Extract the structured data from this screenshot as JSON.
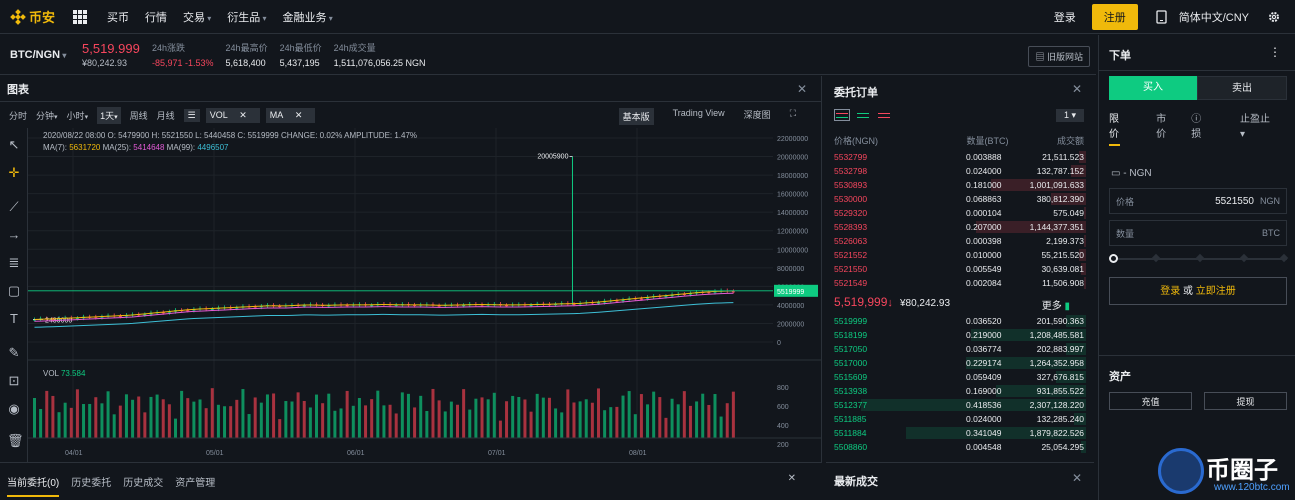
{
  "header": {
    "logo_text": "币安",
    "nav": [
      "买币",
      "行情",
      "交易",
      "衍生品",
      "金融业务"
    ],
    "nav_dropdown": [
      false,
      false,
      true,
      true,
      true
    ],
    "login": "登录",
    "register": "注册",
    "language": "简体中文/CNY"
  },
  "ticker": {
    "pair": "BTC/NGN",
    "last_price": "5,519.999",
    "last_price_cny": "¥80,242.93",
    "change_label": "24h涨跌",
    "change_value": "-85,971 -1.53%",
    "high_label": "24h最高价",
    "high_value": "5,618,400",
    "low_label": "24h最低价",
    "low_value": "5,437,195",
    "volume_label": "24h成交量",
    "volume_value": "1,511,076,056.25 NGN",
    "old_site": "旧版网站"
  },
  "chart_panel": {
    "title": "图表",
    "intervals": [
      "分时",
      "分钟",
      "小时",
      "1天",
      "周线",
      "月线"
    ],
    "indicators": [
      "VOL",
      "MA"
    ],
    "views": [
      "基本版",
      "Trading View",
      "深度图"
    ],
    "ohlc_line": "2020/08/22 08:00  O: 5479900  H: 5521550  L: 5440458  C: 5519999  CHANGE: 0.02%  AMPLITUDE: 1.47%",
    "ma7_label": "MA(7):",
    "ma7_value": "5631720",
    "ma25_label": "MA(25):",
    "ma25_value": "5414648",
    "ma99_label": "MA(99):",
    "ma99_value": "4496507",
    "vol_label": "VOL",
    "vol_value": "73.584",
    "peak_label": "20005900",
    "low_label": "2430000",
    "current_price_tag": "5519999",
    "y_ticks": [
      "22000000",
      "20000000",
      "18000000",
      "16000000",
      "14000000",
      "12000000",
      "10000000",
      "8000000",
      "6000000",
      "4000000",
      "2000000",
      "0"
    ],
    "vol_ticks": [
      "800",
      "600",
      "400",
      "200"
    ],
    "x_ticks": [
      "04/01",
      "05/01",
      "06/01",
      "07/01",
      "08/01"
    ]
  },
  "chart_data": {
    "type": "candlestick",
    "y_range": [
      0,
      23000000
    ],
    "close_trend": [
      2430000,
      2500000,
      2600000,
      2700000,
      2800000,
      2900000,
      3100000,
      3300000,
      3500000,
      3600000,
      3700000,
      3800000,
      3900000,
      3900000,
      4000000,
      3950000,
      4000000,
      4000000,
      4050000,
      4000000,
      4000000,
      3950000,
      4000000,
      4050000,
      4000000,
      4000000,
      4050000,
      4100000,
      4150000,
      4300000,
      4500000,
      4700000,
      4900000,
      5100000,
      5300000,
      5450000,
      5519999
    ],
    "spike": {
      "date": "07/15",
      "high": 20005900
    }
  },
  "orders": {
    "title": "委托订单",
    "group": "1",
    "columns": [
      "价格(NGN)",
      "数量(BTC)",
      "成交额"
    ],
    "asks": [
      [
        "5532799",
        "0.003888",
        "21,511.523",
        0.03
      ],
      [
        "5532798",
        "0.024000",
        "132,787.152",
        0.06
      ],
      [
        "5530893",
        "0.181000",
        "1,001,091.633",
        0.38
      ],
      [
        "5530000",
        "0.068863",
        "380,812.390",
        0.14
      ],
      [
        "5529320",
        "0.000104",
        "575.049",
        0.01
      ],
      [
        "5528393",
        "0.207000",
        "1,144,377.351",
        0.44
      ],
      [
        "5526063",
        "0.000398",
        "2,199.373",
        0.01
      ],
      [
        "5521552",
        "0.010000",
        "55,215.520",
        0.03
      ],
      [
        "5521550",
        "0.005549",
        "30,639.081",
        0.02
      ],
      [
        "5521549",
        "0.002084",
        "11,506.908",
        0.01
      ]
    ],
    "mid_price": "5,519,999",
    "mid_arrow": "↓",
    "mid_cny": "¥80,242.93",
    "more": "更多",
    "bids": [
      [
        "5519999",
        "0.036520",
        "201,590.363",
        0.08
      ],
      [
        "5518199",
        "0.219000",
        "1,208,485.581",
        0.46
      ],
      [
        "5517050",
        "0.036774",
        "202,883.997",
        0.08
      ],
      [
        "5517000",
        "0.229174",
        "1,264,352.958",
        0.48
      ],
      [
        "5515609",
        "0.059409",
        "327,676.815",
        0.12
      ],
      [
        "5513938",
        "0.169000",
        "931,855.522",
        0.36
      ],
      [
        "5512377",
        "0.418536",
        "2,307,128.220",
        0.9
      ],
      [
        "5511885",
        "0.024000",
        "132,285.240",
        0.05
      ],
      [
        "5511884",
        "0.341049",
        "1,879,822.526",
        0.72
      ],
      [
        "5508860",
        "0.004548",
        "25,054.295",
        0.02
      ]
    ]
  },
  "trade": {
    "title": "下单",
    "buy": "买入",
    "sell": "卖出",
    "types": [
      "限价",
      "市价",
      "止盈止损"
    ],
    "balance": "- NGN",
    "price_label": "价格",
    "price_value": "5521550",
    "price_unit": "NGN",
    "amount_label": "数量",
    "amount_unit": "BTC",
    "login_text": "登录",
    "or_text": "或",
    "register_text": "立即注册",
    "assets_title": "资产",
    "deposit": "充值",
    "withdraw": "提现"
  },
  "bottom": {
    "tabs": [
      "当前委托(0)",
      "历史委托",
      "历史成交",
      "资产管理"
    ],
    "recent_trades": "最新成交"
  },
  "watermark": {
    "text": "币圈子",
    "url": "www.120btc.com"
  },
  "colors": {
    "accent": "#f0b90b",
    "up": "#0ecb81",
    "down": "#f6465d",
    "bg": "#12161c"
  }
}
